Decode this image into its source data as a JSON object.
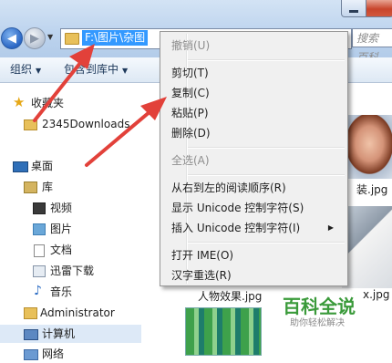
{
  "address": {
    "path": "F:\\图片\\杂图"
  },
  "search": {
    "placeholder": "搜索 百科"
  },
  "toolbar": {
    "organize": "组织",
    "add_to_library": "包含到库中"
  },
  "sidebar": {
    "favorites": "收藏夹",
    "downloads": "2345Downloads",
    "desktop": "桌面",
    "libraries": "库",
    "videos": "视频",
    "pictures": "图片",
    "documents": "文档",
    "xunlei": "迅雷下载",
    "music": "音乐",
    "administrator": "Administrator",
    "computer": "计算机",
    "network": "网络"
  },
  "files": {
    "label_a": "装.jpg",
    "label_b": "人物效果.jpg",
    "label_c": "x.jpg"
  },
  "context_menu": {
    "undo": "撤销(U)",
    "cut": "剪切(T)",
    "copy": "复制(C)",
    "paste": "粘贴(P)",
    "delete": "删除(D)",
    "select_all": "全选(A)",
    "rtl": "从右到左的阅读顺序(R)",
    "show_unicode": "显示 Unicode 控制字符(S)",
    "insert_unicode": "插入 Unicode 控制字符(I)",
    "open_ime": "打开 IME(O)",
    "reconversion": "汉字重选(R)"
  },
  "watermark": {
    "title": "百科全说",
    "subtitle": "助你轻松解决"
  },
  "colors": {
    "selection": "#3399ff",
    "arrow": "#e2413a",
    "accent": "#1e395b"
  }
}
